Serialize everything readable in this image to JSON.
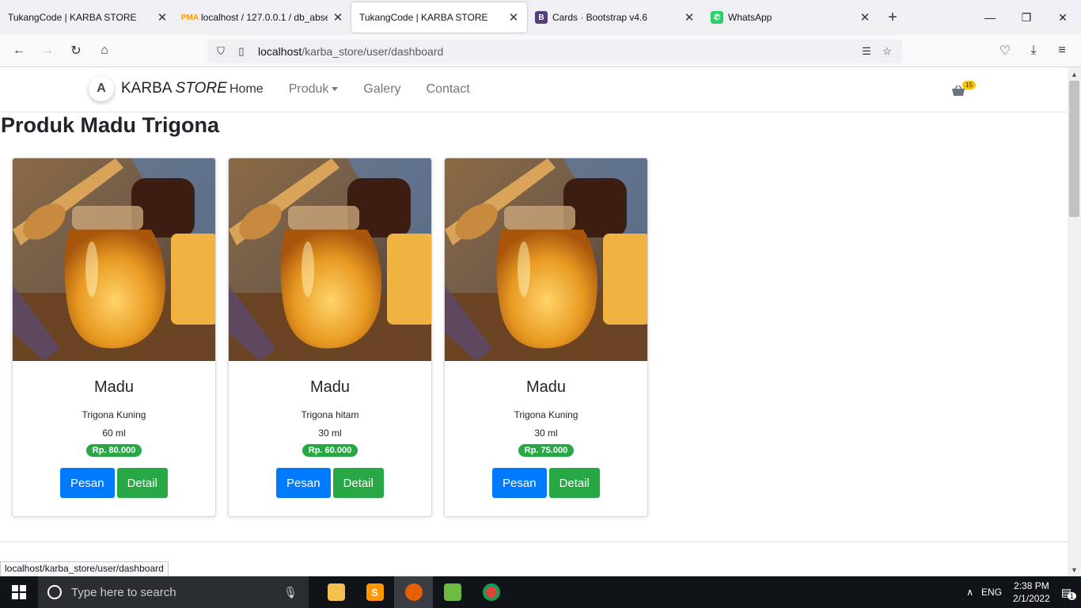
{
  "browser": {
    "tabs": [
      {
        "title": "TukangCode | KARBA STORE",
        "active": false,
        "icon": "none"
      },
      {
        "title": "localhost / 127.0.0.1 / db_absen",
        "active": false,
        "icon": "phpmyadmin-icon"
      },
      {
        "title": "TukangCode | KARBA STORE",
        "active": true,
        "icon": "none"
      },
      {
        "title": "Cards · Bootstrap v4.6",
        "active": false,
        "icon": "bootstrap-icon"
      },
      {
        "title": "WhatsApp",
        "active": false,
        "icon": "whatsapp-icon"
      }
    ],
    "url_host": "localhost",
    "url_path": "/karba_store/user/dashboard",
    "status_tip": "localhost/karba_store/user/dashboard"
  },
  "site": {
    "brand_main": "KARBA",
    "brand_italic": "STORE",
    "logo_letter": "A",
    "nav": [
      {
        "label": "Home",
        "active": true
      },
      {
        "label": "Produk",
        "dropdown": true
      },
      {
        "label": "Galery"
      },
      {
        "label": "Contact"
      }
    ],
    "cart_count": "15",
    "page_title": "Produk Madu Trigona"
  },
  "products": [
    {
      "name": "Madu",
      "variant": "Trigona Kuning",
      "size": "60 ml",
      "price": "Rp. 80.000",
      "order_label": "Pesan",
      "detail_label": "Detail"
    },
    {
      "name": "Madu",
      "variant": "Trigona hitam",
      "size": "30 ml",
      "price": "Rp. 60.000",
      "order_label": "Pesan",
      "detail_label": "Detail"
    },
    {
      "name": "Madu",
      "variant": "Trigona Kuning",
      "size": "30 ml",
      "price": "Rp. 75.000",
      "order_label": "Pesan",
      "detail_label": "Detail"
    }
  ],
  "taskbar": {
    "search_placeholder": "Type here to search",
    "language": "ENG",
    "time": "2:38 PM",
    "date": "2/1/2022",
    "notification_count": "1"
  },
  "colors": {
    "primary": "#007bff",
    "success": "#28a745",
    "badge": "#ffc107"
  }
}
